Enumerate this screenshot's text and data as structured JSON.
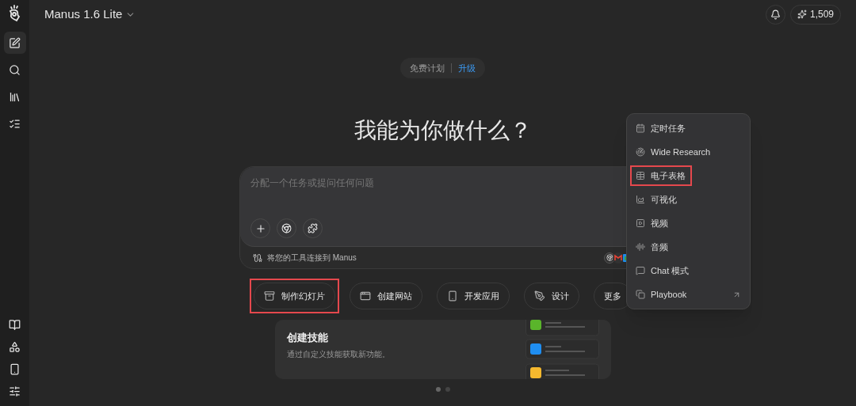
{
  "header": {
    "model": "Manus 1.6 Lite",
    "credits": "1,509"
  },
  "plan": {
    "label": "免费计划",
    "upgrade": "升级"
  },
  "heading": "我能为你做什么？",
  "composer": {
    "placeholder": "分配一个任务或提问任何问题",
    "connect_label": "将您的工具连接到 Manus"
  },
  "chips": [
    {
      "label": "制作幻灯片",
      "highlighted": true
    },
    {
      "label": "创建网站",
      "highlighted": false
    },
    {
      "label": "开发应用",
      "highlighted": false
    },
    {
      "label": "设计",
      "highlighted": false
    },
    {
      "label": "更多",
      "highlighted": false
    }
  ],
  "skill_card": {
    "title": "创建技能",
    "description": "通过自定义技能获取新功能。"
  },
  "carousel": [
    {
      "selected": true
    },
    {
      "selected": false
    }
  ],
  "menu": [
    {
      "label": "定时任务",
      "highlighted": false,
      "external": false
    },
    {
      "label": "Wide Research",
      "highlighted": false,
      "external": false
    },
    {
      "label": "电子表格",
      "highlighted": true,
      "external": false
    },
    {
      "label": "可视化",
      "highlighted": false,
      "external": false
    },
    {
      "label": "视频",
      "highlighted": false,
      "external": false
    },
    {
      "label": "音频",
      "highlighted": false,
      "external": false
    },
    {
      "label": "Chat 模式",
      "highlighted": false,
      "external": false
    },
    {
      "label": "Playbook",
      "highlighted": false,
      "external": true
    }
  ]
}
